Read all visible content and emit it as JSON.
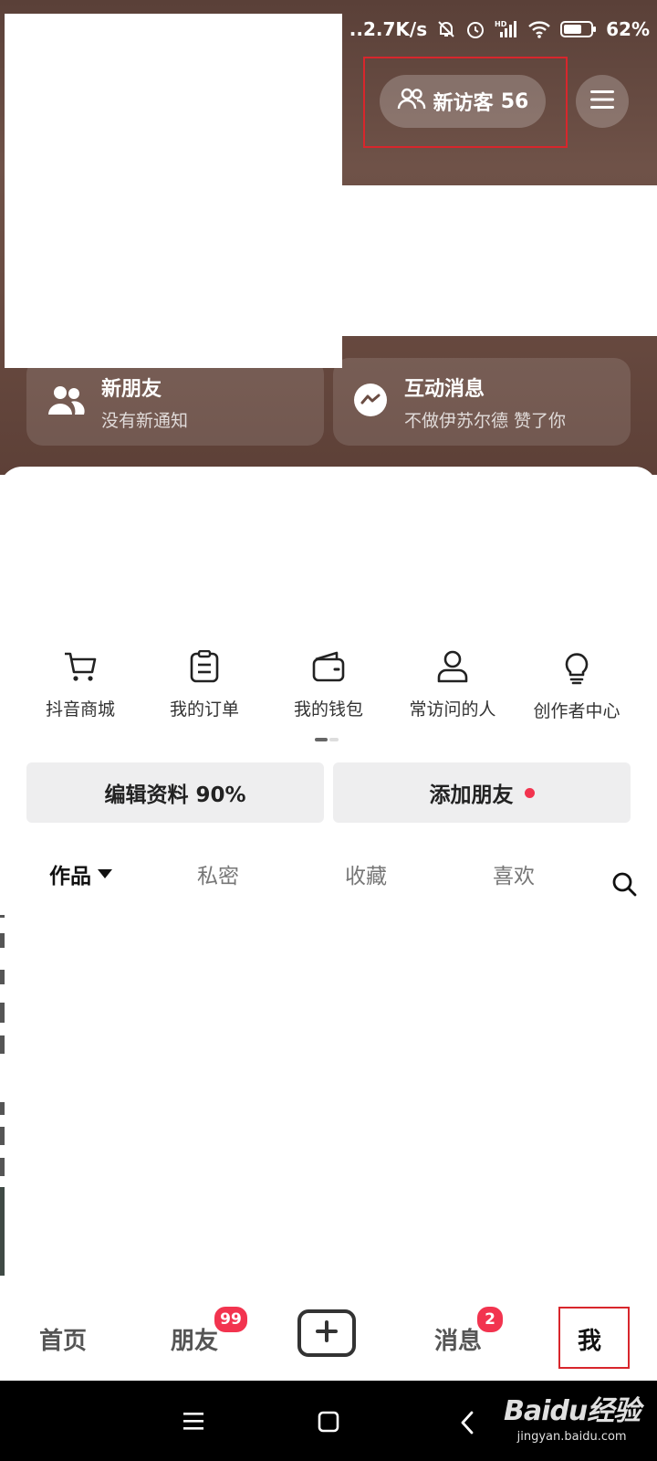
{
  "status_bar": {
    "net_speed": "..2.7K/s",
    "network_tag": "HD",
    "battery": "62%"
  },
  "header": {
    "visitor_label": "新访客",
    "visitor_count": "56"
  },
  "notice_cards": [
    {
      "title": "新朋友",
      "subtitle": "没有新通知",
      "icon": "people-icon"
    },
    {
      "title": "互动消息",
      "subtitle": "不做伊苏尔德 赞了你",
      "icon": "chat-bubble-icon"
    }
  ],
  "shortcuts": [
    {
      "label": "抖音商城",
      "icon": "cart-icon"
    },
    {
      "label": "我的订单",
      "icon": "clipboard-icon"
    },
    {
      "label": "我的钱包",
      "icon": "wallet-icon"
    },
    {
      "label": "常访问的人",
      "icon": "person-icon"
    },
    {
      "label": "创作者中心",
      "icon": "lightbulb-icon"
    }
  ],
  "actions": {
    "edit_profile": "编辑资料 90%",
    "add_friend": "添加朋友"
  },
  "tabs": [
    {
      "label": "作品",
      "active": true
    },
    {
      "label": "私密"
    },
    {
      "label": "收藏"
    },
    {
      "label": "喜欢"
    }
  ],
  "bottom_nav": {
    "home": "首页",
    "friends": "朋友",
    "friends_badge": "99",
    "messages": "消息",
    "messages_badge": "2",
    "me": "我"
  },
  "watermark": {
    "main": "Baidu经验",
    "url": "jingyan.baidu.com"
  },
  "colors": {
    "accent_red": "#f2344f",
    "highlight_frame": "#d8262c",
    "header_brown": "#6a4c42"
  }
}
